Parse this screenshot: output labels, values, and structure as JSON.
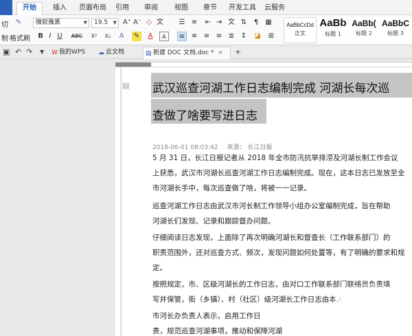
{
  "menu": {
    "tabs": [
      "开始",
      "插入",
      "页面布局",
      "引用",
      "审阅",
      "视图",
      "章节",
      "开发工具",
      "云服务"
    ]
  },
  "ribbon": {
    "clip_labels": [
      "切",
      "制",
      "格式刷"
    ],
    "font_name": "微软雅黑",
    "font_size": "19.5",
    "grow_font": "A⁺",
    "shrink_font": "A⁻",
    "format_buttons": [
      "B",
      "I",
      "U",
      "ABC",
      "X²",
      "X₂"
    ],
    "styles": [
      {
        "sample": "AaBbCcDd",
        "name": "正文"
      },
      {
        "sample": "AaBb",
        "name": "标题 1"
      },
      {
        "sample": "AaBb(",
        "name": "标题 2"
      },
      {
        "sample": "AaBbC",
        "name": "标题 3"
      }
    ]
  },
  "doc_tabs": [
    {
      "label": "我的WPS",
      "icon": "wps-icon"
    },
    {
      "label": "云文档",
      "icon": "cloud-icon"
    },
    {
      "label": "新建 DOC 文档.doc *",
      "icon": "doc-icon"
    }
  ],
  "new_tab_label": "+",
  "document": {
    "title_line1": "武汉巡查河湖工作日志编制完成  河湖长每次巡",
    "title_line2": "查做了啥要写进日志",
    "date": "2018-06-01 08:03:42",
    "source": "来源：  长江日报",
    "paragraphs": [
      "    5 月 31 日，长江日报记者从 2018 年全市防汛抗旱排涝及河湖长制工作会议",
      "上获悉，武汉市河湖长巡查河湖工作日志编制完成。现在，这本日志已发放至全",
      "市河湖长手中，每次巡查做了啥，将被一一记录。",
      "    巡查河湖工作日志由武汉市河长制工作领导小组办公室编制完成，旨在帮助",
      "河湖长们发现、记录和跟踪督办问题。",
      "    仔细阅读日志发现，上面除了再次明确河湖长和督查长（工作联系部门）的",
      "职责范围外，还对巡查方式、频次，发现问题如何处置等，有了明确的要求和规",
      "定。",
      "    按照规定，市、区级河湖长的工作日志，由对口工作联系部门联络员负责填",
      "写并保管，街（乡镇）、村（社区）级河湖长工作日志由本人",
      "    市河长办负责人表示，启用工作日",
      "责，规范巡查河湖事项，推动和保障河湖"
    ]
  }
}
